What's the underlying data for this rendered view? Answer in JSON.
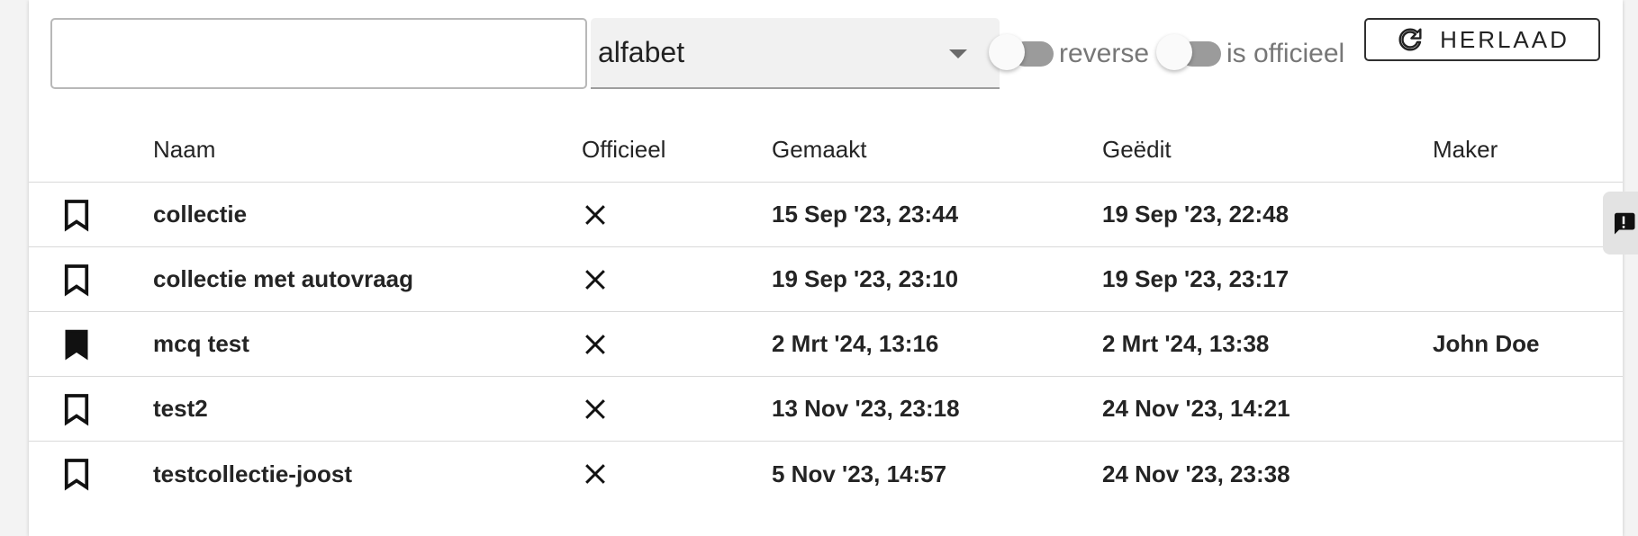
{
  "filters": {
    "search_value": "",
    "search_placeholder": "",
    "sort_value": "alfabet",
    "reverse_label": "reverse",
    "official_label": "is officieel",
    "reload_label": "HERLAAD"
  },
  "table": {
    "headers": {
      "name": "Naam",
      "official": "Officieel",
      "created": "Gemaakt",
      "edited": "Geëdit",
      "maker": "Maker"
    },
    "rows": [
      {
        "bookmark": "bookmark-outline-icon",
        "name": "collectie",
        "official": "close-icon",
        "created": "15 Sep '23, 23:44",
        "edited": "19 Sep '23, 22:48",
        "maker": ""
      },
      {
        "bookmark": "bookmark-outline-icon",
        "name": "collectie met autovraag",
        "official": "close-icon",
        "created": "19 Sep '23, 23:10",
        "edited": "19 Sep '23, 23:17",
        "maker": ""
      },
      {
        "bookmark": "bookmark-filled-icon",
        "name": "mcq test",
        "official": "close-icon",
        "created": "2 Mrt '24, 13:16",
        "edited": "2 Mrt '24, 13:38",
        "maker": "John Doe"
      },
      {
        "bookmark": "bookmark-outline-icon",
        "name": "test2",
        "official": "close-icon",
        "created": "13 Nov '23, 23:18",
        "edited": "24 Nov '23, 14:21",
        "maker": ""
      },
      {
        "bookmark": "bookmark-outline-icon",
        "name": "testcollectie-joost",
        "official": "close-icon",
        "created": "5 Nov '23, 14:57",
        "edited": "24 Nov '23, 23:38",
        "maker": ""
      }
    ]
  },
  "colors": {
    "card_background": "#ffffff",
    "page_background": "#f3f3f3",
    "text": "#242424",
    "muted_text": "#777777",
    "divider": "#d9d9d9",
    "switch_track": "#9b9b9b",
    "feedback_tab": "#e3e3e3"
  },
  "icons": {
    "sort_dropdown": "chevron-down-icon",
    "reload": "refresh-icon",
    "feedback": "feedback-icon"
  }
}
